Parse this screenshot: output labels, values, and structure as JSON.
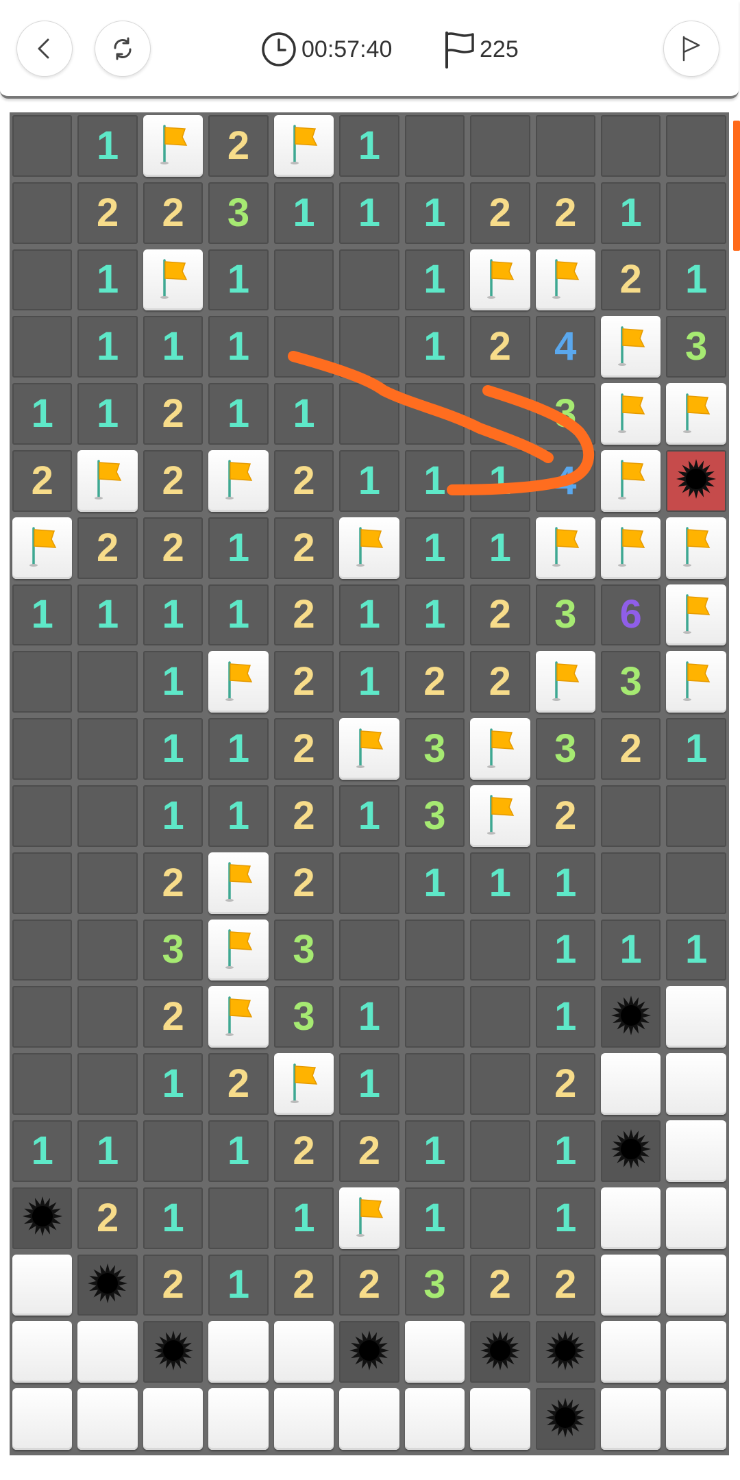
{
  "header": {
    "timer": "00:57:40",
    "flag_count": "225"
  },
  "board": {
    "cols": 11,
    "rows": [
      [
        "R",
        "1",
        "F",
        "2",
        "F",
        "1",
        "R",
        "R",
        "R",
        "R",
        "R"
      ],
      [
        "R",
        "2",
        "2",
        "3",
        "1",
        "1",
        "1",
        "2",
        "2",
        "1",
        "R"
      ],
      [
        "R",
        "1",
        "F",
        "1",
        "R",
        "R",
        "1",
        "F",
        "F",
        "2",
        "1"
      ],
      [
        "R",
        "1",
        "1",
        "1",
        "R",
        "R",
        "1",
        "2",
        "4",
        "F",
        "3"
      ],
      [
        "1",
        "1",
        "2",
        "1",
        "1",
        "R",
        "R",
        "R",
        "3",
        "F",
        "F"
      ],
      [
        "2",
        "F",
        "2",
        "F",
        "2",
        "1",
        "1",
        "1",
        "4",
        "F",
        "X"
      ],
      [
        "F",
        "2",
        "2",
        "1",
        "2",
        "F",
        "1",
        "1",
        "F",
        "F",
        "F"
      ],
      [
        "1",
        "1",
        "1",
        "1",
        "2",
        "1",
        "1",
        "2",
        "3",
        "6",
        "F"
      ],
      [
        "R",
        "R",
        "1",
        "F",
        "2",
        "1",
        "2",
        "2",
        "F",
        "3",
        "F"
      ],
      [
        "R",
        "R",
        "1",
        "1",
        "2",
        "F",
        "3",
        "F",
        "3",
        "2",
        "1"
      ],
      [
        "R",
        "R",
        "1",
        "1",
        "2",
        "1",
        "3",
        "F",
        "2",
        "R",
        "R"
      ],
      [
        "R",
        "R",
        "2",
        "F",
        "2",
        "R",
        "1",
        "1",
        "1",
        "R",
        "R"
      ],
      [
        "R",
        "R",
        "3",
        "F",
        "3",
        "R",
        "R",
        "R",
        "1",
        "1",
        "1"
      ],
      [
        "R",
        "R",
        "2",
        "F",
        "3",
        "1",
        "R",
        "R",
        "1",
        "M",
        "H"
      ],
      [
        "R",
        "R",
        "1",
        "2",
        "F",
        "1",
        "R",
        "R",
        "2",
        "H",
        "H"
      ],
      [
        "1",
        "1",
        "R",
        "1",
        "2",
        "2",
        "1",
        "R",
        "1",
        "M",
        "H"
      ],
      [
        "M",
        "2",
        "1",
        "R",
        "1",
        "F",
        "1",
        "R",
        "1",
        "H",
        "H"
      ],
      [
        "H",
        "M",
        "2",
        "1",
        "2",
        "2",
        "3",
        "2",
        "2",
        "H",
        "H"
      ],
      [
        "H",
        "H",
        "M",
        "H",
        "H",
        "M",
        "H",
        "M",
        "M",
        "H",
        "H"
      ],
      [
        "H",
        "H",
        "H",
        "H",
        "H",
        "H",
        "H",
        "H",
        "M",
        "H",
        "H"
      ]
    ]
  },
  "colors": {
    "n1": "#5ee8c8",
    "n2": "#f7dc8a",
    "n3": "#a6ea72",
    "n4": "#5aa8ee",
    "n6": "#8f5ee8",
    "flag": "#ffb300",
    "stroke": "#ff6d1f"
  }
}
